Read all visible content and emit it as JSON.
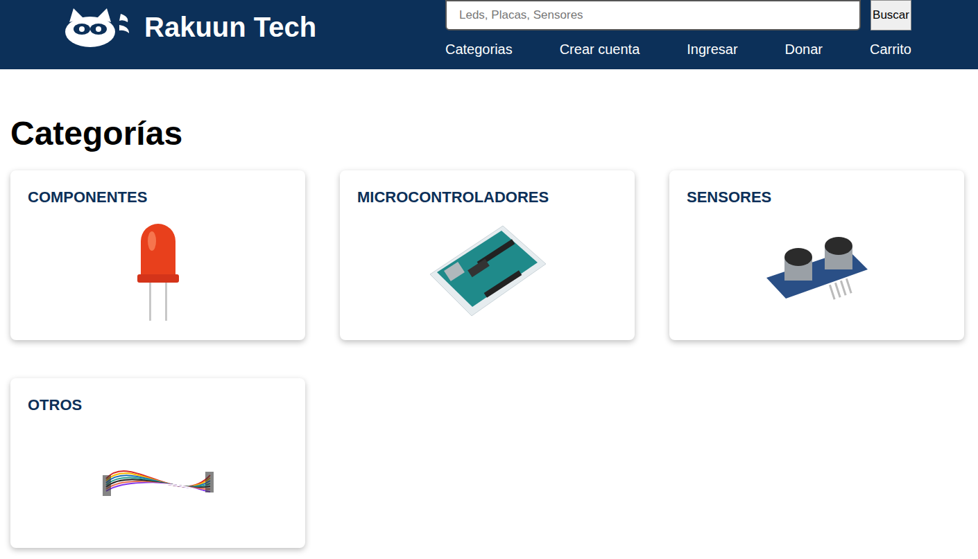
{
  "header": {
    "logo": "Rakuun Tech",
    "search": {
      "placeholder": "Leds, Placas, Sensores"
    },
    "search_button": "Buscar",
    "nav": [
      "Categorias",
      "Crear cuenta",
      "Ingresar",
      "Donar",
      "Carrito"
    ]
  },
  "page": {
    "title": "Categorías"
  },
  "categories": [
    {
      "name": "COMPONENTES"
    },
    {
      "name": "MICROCONTROLADORES"
    },
    {
      "name": "SENSORES"
    },
    {
      "name": "OTROS"
    }
  ]
}
